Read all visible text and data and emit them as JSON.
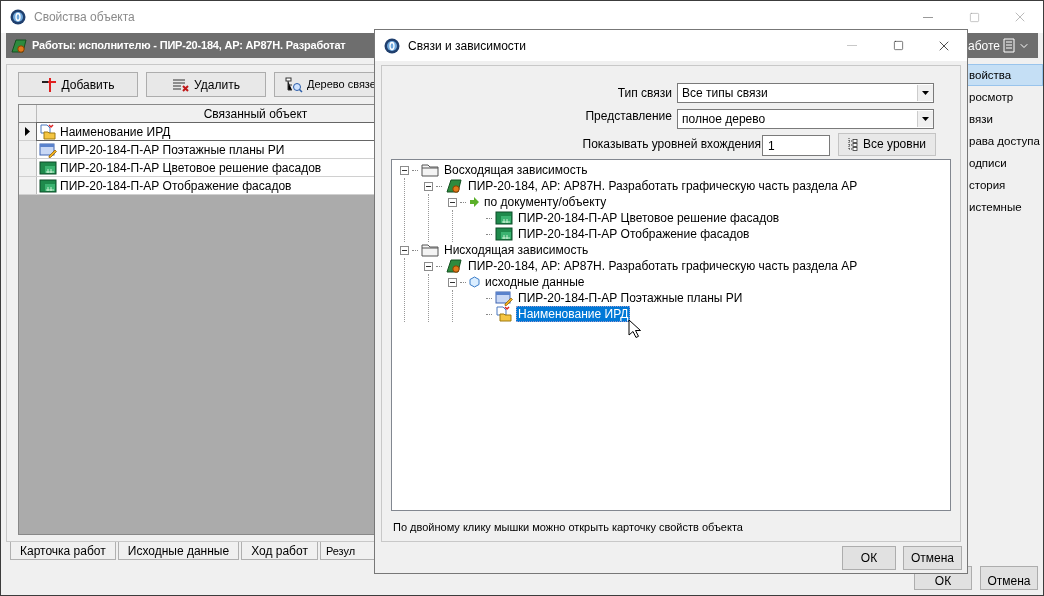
{
  "window": {
    "title": "Свойства объекта"
  },
  "header": {
    "title": "Работы: исполнителю - ПИР-20-184, АР: АР87Н. Разработат",
    "right_text": "аботе"
  },
  "toolbar": [
    {
      "kind": "add",
      "label": "Добавить"
    },
    {
      "kind": "delete",
      "label": "Удалить"
    },
    {
      "kind": "tree",
      "label": "Дерево связе"
    }
  ],
  "table": {
    "columns": [
      "Связанный объект"
    ],
    "rows": [
      {
        "kind": "ird",
        "text": "Наименование ИРД",
        "selected": true
      },
      {
        "kind": "plan",
        "text": "ПИР-20-184-П-АР Поэтажные планы РИ",
        "selected": false
      },
      {
        "kind": "drawing",
        "text": "ПИР-20-184-П-АР Цветовое решение фасадов",
        "selected": false
      },
      {
        "kind": "drawing",
        "text": "ПИР-20-184-П-АР Отображение фасадов",
        "selected": false
      }
    ]
  },
  "bottom_tabs": [
    "Карточка работ",
    "Исходные данные",
    "Ход работ",
    "Резул"
  ],
  "sidebar": {
    "items": [
      {
        "label": "войства",
        "selected": true
      },
      {
        "label": "росмотр",
        "selected": false
      },
      {
        "label": "вязи",
        "selected": false
      },
      {
        "label": "рава доступа",
        "selected": false
      },
      {
        "label": "одписи",
        "selected": false
      },
      {
        "label": "стория",
        "selected": false
      },
      {
        "label": "истемные",
        "selected": false
      }
    ]
  },
  "buttons": [
    "ОК",
    "Отмена"
  ],
  "dialog": {
    "title": "Связи и зависимости",
    "link_type": {
      "label": "Тип связи",
      "value": "Все типы связи"
    },
    "view": {
      "label": "Представление",
      "value": "полное дерево"
    },
    "levels": {
      "label": "Показывать уровней вхождения",
      "value": "1",
      "button": "Все уровни"
    },
    "tree": [
      {
        "kind": "folder",
        "text": "Восходящая зависимость",
        "expanded": true,
        "selected": false,
        "children": [
          {
            "kind": "task",
            "text": "ПИР-20-184, АР: АР87Н. Разработать графическую часть раздела АР",
            "expanded": true,
            "selected": false,
            "children": [
              {
                "kind": "link",
                "text": "по документу/объекту",
                "expanded": true,
                "selected": false,
                "children": [
                  {
                    "kind": "drawing",
                    "text": "ПИР-20-184-П-АР Цветовое решение фасадов",
                    "selected": false
                  },
                  {
                    "kind": "drawing",
                    "text": "ПИР-20-184-П-АР Отображение фасадов",
                    "selected": false
                  }
                ]
              }
            ]
          }
        ]
      },
      {
        "kind": "folder",
        "text": "Нисходящая зависимость",
        "expanded": true,
        "selected": false,
        "children": [
          {
            "kind": "task",
            "text": "ПИР-20-184, АР: АР87Н. Разработать графическую часть раздела АР",
            "expanded": true,
            "selected": false,
            "children": [
              {
                "kind": "source",
                "text": "исходные данные",
                "expanded": true,
                "selected": false,
                "children": [
                  {
                    "kind": "plan",
                    "text": "ПИР-20-184-П-АР Поэтажные планы РИ",
                    "selected": false
                  },
                  {
                    "kind": "ird",
                    "text": "Наименование ИРД",
                    "selected": true
                  }
                ]
              }
            ]
          }
        ]
      }
    ],
    "hint": "По двойному клику мышки можно открыть карточку свойств объекта",
    "buttons": [
      "ОК",
      "Отмена"
    ]
  }
}
